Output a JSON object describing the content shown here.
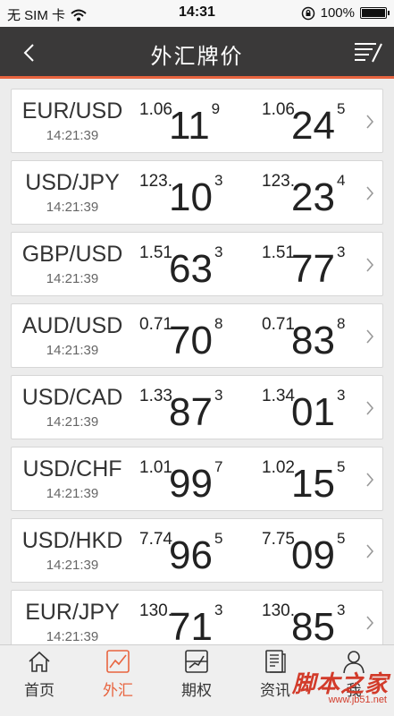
{
  "status": {
    "carrier": "无 SIM 卡",
    "time": "14:31",
    "battery": "100%",
    "battery_level": 1.0
  },
  "nav": {
    "title": "外汇牌价",
    "back_icon": "chevron-left-icon",
    "menu_icon": "list-edit-icon"
  },
  "quotes": [
    {
      "pair": "EUR/USD",
      "time": "14:21:39",
      "bid": {
        "pre": "1.06",
        "big": "11",
        "sup": "9"
      },
      "ask": {
        "pre": "1.06",
        "big": "24",
        "sup": "5"
      }
    },
    {
      "pair": "USD/JPY",
      "time": "14:21:39",
      "bid": {
        "pre": "123.",
        "big": "10",
        "sup": "3"
      },
      "ask": {
        "pre": "123.",
        "big": "23",
        "sup": "4"
      }
    },
    {
      "pair": "GBP/USD",
      "time": "14:21:39",
      "bid": {
        "pre": "1.51",
        "big": "63",
        "sup": "3"
      },
      "ask": {
        "pre": "1.51",
        "big": "77",
        "sup": "3"
      }
    },
    {
      "pair": "AUD/USD",
      "time": "14:21:39",
      "bid": {
        "pre": "0.71",
        "big": "70",
        "sup": "8"
      },
      "ask": {
        "pre": "0.71",
        "big": "83",
        "sup": "8"
      }
    },
    {
      "pair": "USD/CAD",
      "time": "14:21:39",
      "bid": {
        "pre": "1.33",
        "big": "87",
        "sup": "3"
      },
      "ask": {
        "pre": "1.34",
        "big": "01",
        "sup": "3"
      }
    },
    {
      "pair": "USD/CHF",
      "time": "14:21:39",
      "bid": {
        "pre": "1.01",
        "big": "99",
        "sup": "7"
      },
      "ask": {
        "pre": "1.02",
        "big": "15",
        "sup": "5"
      }
    },
    {
      "pair": "USD/HKD",
      "time": "14:21:39",
      "bid": {
        "pre": "7.74",
        "big": "96",
        "sup": "5"
      },
      "ask": {
        "pre": "7.75",
        "big": "09",
        "sup": "5"
      }
    },
    {
      "pair": "EUR/JPY",
      "time": "14:21:39",
      "bid": {
        "pre": "130.",
        "big": "71",
        "sup": "3"
      },
      "ask": {
        "pre": "130.",
        "big": "85",
        "sup": "3"
      }
    }
  ],
  "tabs": [
    {
      "label": "首页",
      "icon": "home-icon",
      "active": false
    },
    {
      "label": "外汇",
      "icon": "line-chart-icon",
      "active": true
    },
    {
      "label": "期权",
      "icon": "options-chart-icon",
      "active": false
    },
    {
      "label": "资讯",
      "icon": "news-icon",
      "active": false
    },
    {
      "label": "我",
      "icon": "user-icon",
      "active": false
    }
  ],
  "watermark": {
    "text": "脚本之家",
    "url": "www.jb51.net"
  },
  "colors": {
    "accent": "#e8643f",
    "nav_bg": "#3a3939",
    "page_bg": "#ececec"
  }
}
